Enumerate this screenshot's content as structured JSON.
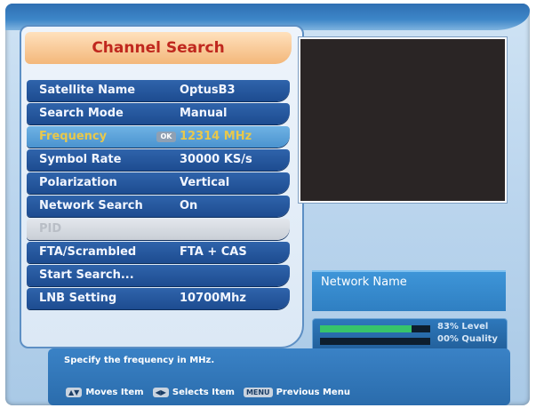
{
  "title": "Channel Search",
  "menu": [
    {
      "label": "Satellite Name",
      "value": "OptusB3",
      "state": "normal"
    },
    {
      "label": "Search Mode",
      "value": "Manual",
      "state": "normal"
    },
    {
      "label": "Frequency",
      "value": "12314 MHz",
      "state": "selected",
      "badge": "OK"
    },
    {
      "label": "Symbol Rate",
      "value": "30000 KS/s",
      "state": "normal"
    },
    {
      "label": "Polarization",
      "value": "Vertical",
      "state": "normal"
    },
    {
      "label": "Network Search",
      "value": "On",
      "state": "normal"
    },
    {
      "label": "PID",
      "value": "",
      "state": "disabled"
    },
    {
      "label": "FTA/Scrambled",
      "value": "FTA + CAS",
      "state": "normal"
    },
    {
      "label": "Start Search...",
      "value": "",
      "state": "normal"
    },
    {
      "label": "LNB Setting",
      "value": "10700Mhz",
      "state": "normal"
    }
  ],
  "network": {
    "label": "Network Name"
  },
  "signal": {
    "level_text": "83% Level",
    "quality_text": "00% Quality",
    "level": 0.83,
    "quality": 0.0
  },
  "help": {
    "text": "Specify the frequency in MHz.",
    "legend": [
      {
        "icon": "up-down-arrow-icon",
        "key": "▲▼",
        "label": "Moves Item"
      },
      {
        "icon": "left-right-arrow-icon",
        "key": "◀▶",
        "label": "Selects Item"
      },
      {
        "icon": "menu-key-icon",
        "key": "MENU",
        "label": "Previous Menu"
      }
    ]
  },
  "colors": {
    "level_bar": "#37c46a",
    "quality_bar": "#2fa3a0",
    "title_text": "#c0281e",
    "selected_text": "#e8c84b"
  }
}
